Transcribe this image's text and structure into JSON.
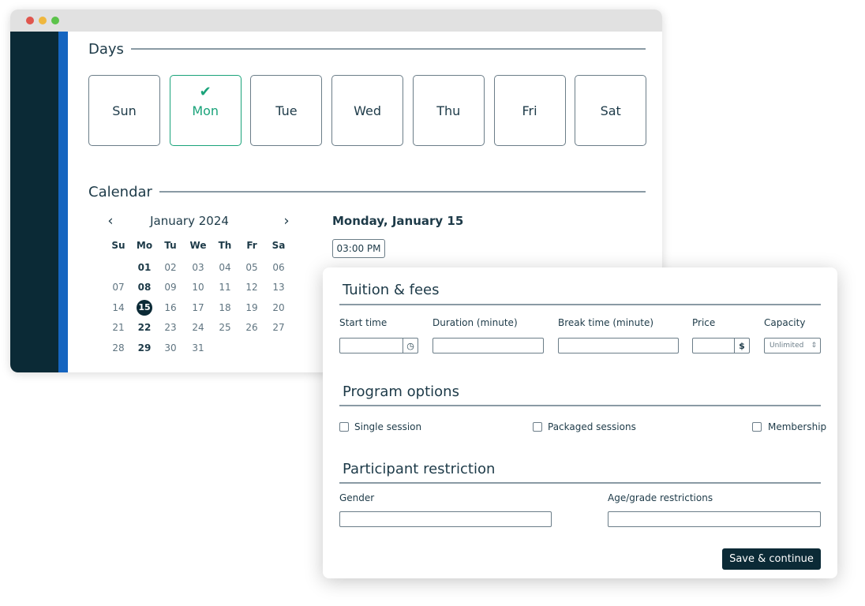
{
  "colors": {
    "sidebar": "#0b2a36",
    "accent_blue": "#1565c0",
    "selected_green": "#1aa37a",
    "primary": "#0b2a36"
  },
  "days": {
    "title": "Days",
    "items": [
      {
        "label": "Sun",
        "selected": false
      },
      {
        "label": "Mon",
        "selected": true
      },
      {
        "label": "Tue",
        "selected": false
      },
      {
        "label": "Wed",
        "selected": false
      },
      {
        "label": "Thu",
        "selected": false
      },
      {
        "label": "Fri",
        "selected": false
      },
      {
        "label": "Sat",
        "selected": false
      }
    ]
  },
  "calendar": {
    "title": "Calendar",
    "month": "January 2024",
    "weekdays": [
      "Su",
      "Mo",
      "Tu",
      "We",
      "Th",
      "Fr",
      "Sa"
    ],
    "weeks": [
      [
        "",
        "01",
        "02",
        "03",
        "04",
        "05",
        "06"
      ],
      [
        "07",
        "08",
        "09",
        "10",
        "11",
        "12",
        "13"
      ],
      [
        "14",
        "15",
        "16",
        "17",
        "18",
        "19",
        "20"
      ],
      [
        "21",
        "22",
        "23",
        "24",
        "25",
        "26",
        "27"
      ],
      [
        "28",
        "29",
        "30",
        "31",
        "",
        "",
        ""
      ]
    ],
    "selected_day": "15",
    "selected_date_label": "Monday, January 15",
    "time_slot": "03:00 PM"
  },
  "tuition": {
    "title": "Tuition & fees",
    "start_time_label": "Start time",
    "duration_label": "Duration (minute)",
    "break_label": "Break time (minute)",
    "price_label": "Price",
    "price_suffix": "$",
    "capacity_label": "Capacity",
    "capacity_value": "Unlimited"
  },
  "program": {
    "title": "Program options",
    "options": [
      "Single session",
      "Packaged sessions",
      "Membership"
    ]
  },
  "participant": {
    "title": "Participant restriction",
    "gender_label": "Gender",
    "age_label": "Age/grade restrictions"
  },
  "save_label": "Save & continue"
}
